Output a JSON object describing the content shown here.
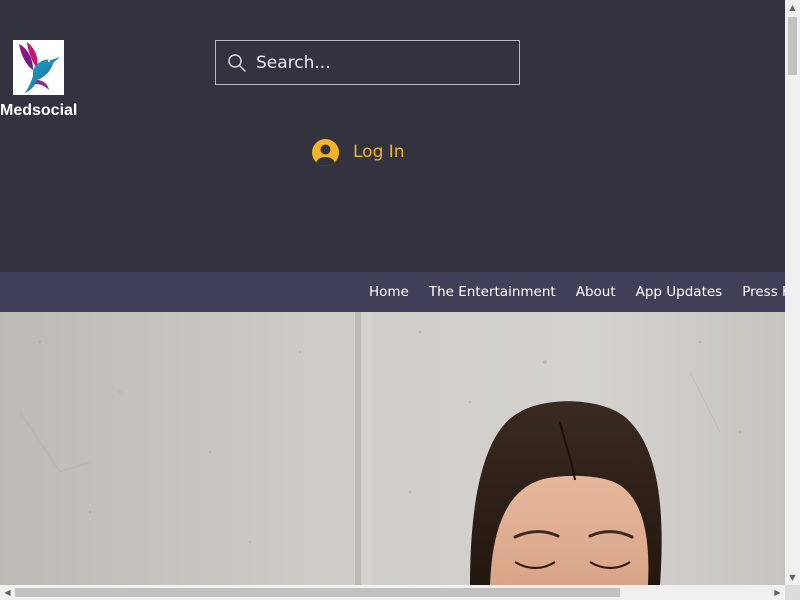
{
  "header": {
    "brand_name": "Medsocial",
    "logo_icon": "hummingbird-logo",
    "search": {
      "placeholder": "Search...",
      "value": "",
      "icon": "search-icon"
    },
    "login": {
      "label": "Log In",
      "icon": "user-avatar-icon",
      "color": "#f5b326"
    },
    "background_color": "#33333f"
  },
  "nav": {
    "background_color": "#3f4057",
    "items": [
      {
        "label": "Home"
      },
      {
        "label": "The Entertainment"
      },
      {
        "label": "About"
      },
      {
        "label": "App Updates"
      },
      {
        "label": "Press Kit"
      }
    ]
  },
  "hero": {
    "description_icon": "hero-photo-woman"
  },
  "scrollbars": {
    "vertical_position": 0.0,
    "horizontal_position": 0.0
  }
}
